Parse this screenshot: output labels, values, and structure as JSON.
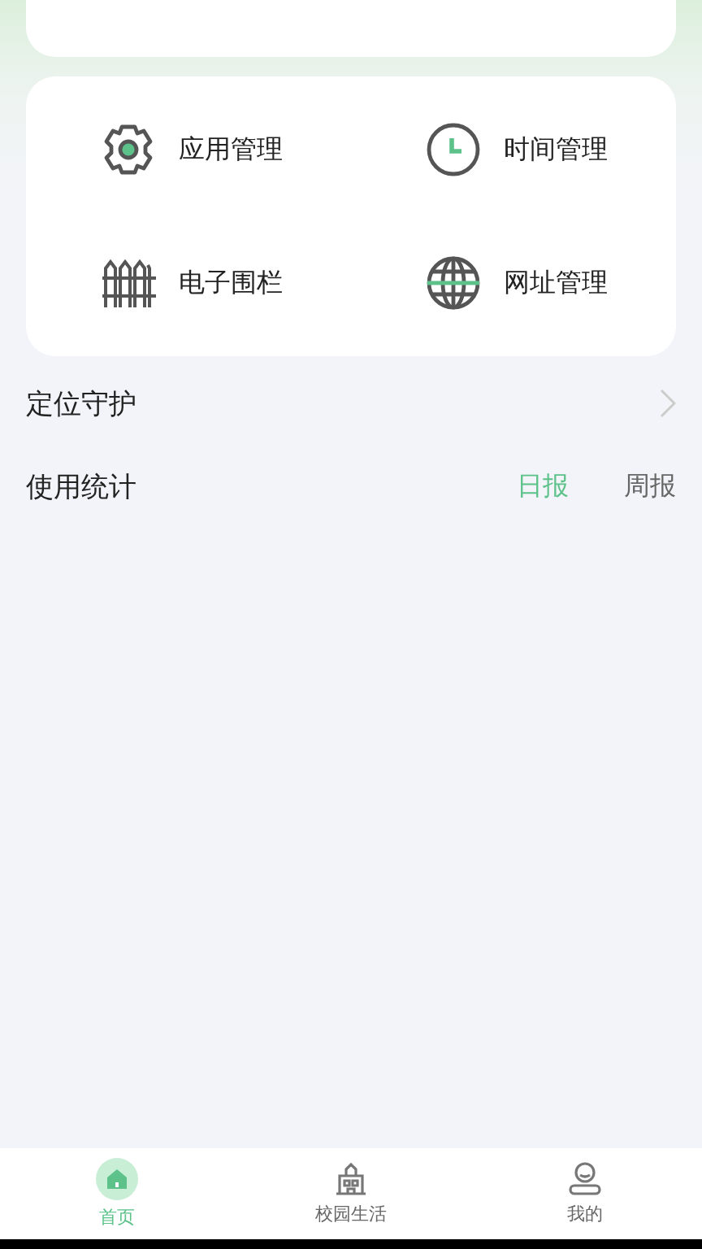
{
  "features": [
    {
      "kind": "gear",
      "label": "应用管理"
    },
    {
      "kind": "clock",
      "label": "时间管理"
    },
    {
      "kind": "fence",
      "label": "电子围栏"
    },
    {
      "kind": "globe",
      "label": "网址管理"
    }
  ],
  "location_row": {
    "label": "定位守护"
  },
  "usage": {
    "title": "使用统计",
    "tabs": [
      {
        "label": "日报",
        "selected": true
      },
      {
        "label": "周报",
        "selected": false
      }
    ]
  },
  "bottom_nav": [
    {
      "kind": "home",
      "label": "首页",
      "selected": true
    },
    {
      "kind": "school",
      "label": "校园生活",
      "selected": false
    },
    {
      "kind": "profile",
      "label": "我的",
      "selected": false
    }
  ]
}
